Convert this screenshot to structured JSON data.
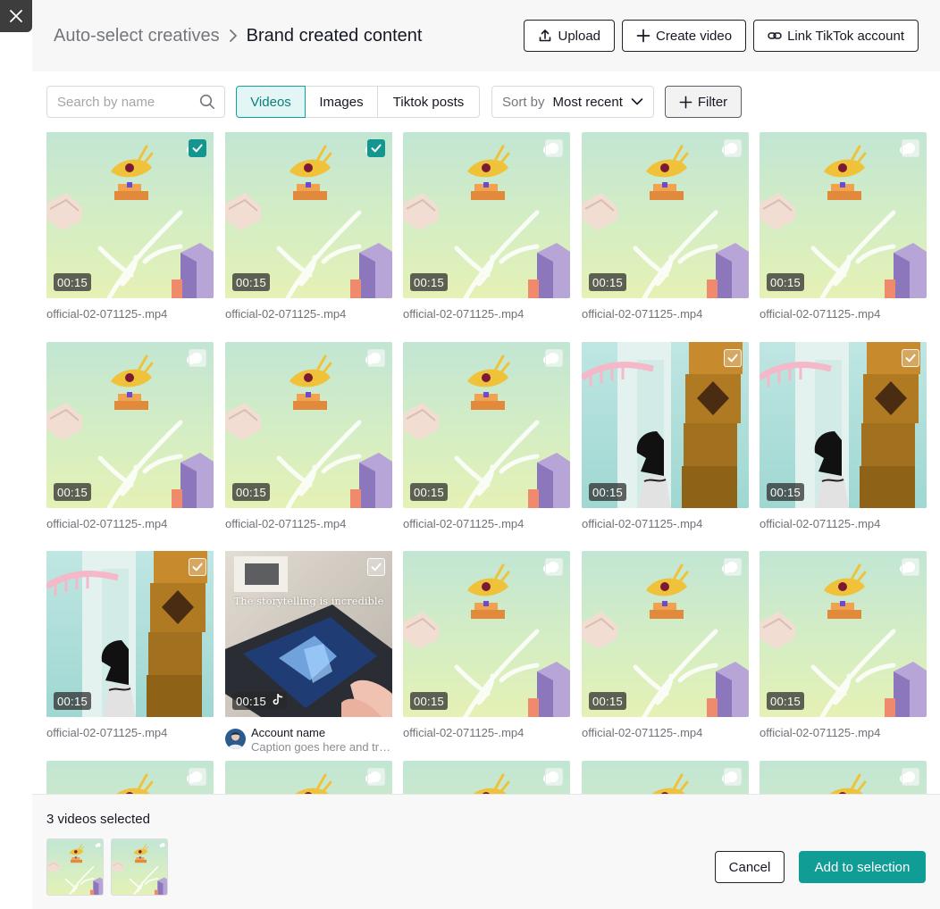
{
  "header": {
    "breadcrumb_parent": "Auto-select creatives",
    "breadcrumb_current": "Brand created content",
    "upload_label": "Upload",
    "create_video_label": "Create video",
    "link_tiktok_label": "Link TikTok account"
  },
  "toolbar": {
    "search_placeholder": "Search by name",
    "tabs": [
      "Videos",
      "Images",
      "Tiktok posts"
    ],
    "active_tab": "Videos",
    "sort_label": "Sort by",
    "sort_value": "Most recent",
    "filter_label": "Filter"
  },
  "grid": {
    "items": [
      {
        "art": "scene",
        "duration": "00:15",
        "name": "official-02-071125-.mp4",
        "checked": true
      },
      {
        "art": "scene",
        "duration": "00:15",
        "name": "official-02-071125-.mp4",
        "checked": true
      },
      {
        "art": "scene",
        "duration": "00:15",
        "name": "official-02-071125-.mp4",
        "checked": false
      },
      {
        "art": "scene",
        "duration": "00:15",
        "name": "official-02-071125-.mp4",
        "checked": false
      },
      {
        "art": "scene",
        "duration": "00:15",
        "name": "official-02-071125-.mp4",
        "checked": false
      },
      {
        "art": "scene",
        "duration": "00:15",
        "name": "official-02-071125-.mp4",
        "checked": false
      },
      {
        "art": "scene",
        "duration": "00:15",
        "name": "official-02-071125-.mp4",
        "checked": false
      },
      {
        "art": "scene",
        "duration": "00:15",
        "name": "official-02-071125-.mp4",
        "checked": false
      },
      {
        "art": "tower",
        "duration": "00:15",
        "name": "official-02-071125-.mp4",
        "checked": false,
        "muted": true
      },
      {
        "art": "tower",
        "duration": "00:15",
        "name": "official-02-071125-.mp4",
        "checked": false,
        "muted": true
      },
      {
        "art": "tower",
        "duration": "00:15",
        "name": "official-02-071125-.mp4",
        "checked": false,
        "muted": true
      },
      {
        "art": "tablet",
        "duration": "00:15",
        "overlay": "The storytelling is incredible",
        "tiktok": true,
        "account": "Account name",
        "caption": "Caption goes here and truncates",
        "checked": false,
        "muted": true
      },
      {
        "art": "scene",
        "duration": "00:15",
        "name": "official-02-071125-.mp4",
        "checked": false
      },
      {
        "art": "scene",
        "duration": "00:15",
        "name": "official-02-071125-.mp4",
        "checked": false
      },
      {
        "art": "scene",
        "duration": "00:15",
        "name": "official-02-071125-.mp4",
        "checked": false
      },
      {
        "art": "scene",
        "checked": false
      },
      {
        "art": "scene",
        "checked": false
      },
      {
        "art": "scene",
        "checked": false
      },
      {
        "art": "scene",
        "checked": false
      },
      {
        "art": "scene",
        "checked": false
      }
    ]
  },
  "footer": {
    "selected_text": "3 videos selected",
    "cancel_label": "Cancel",
    "add_label": "Add to selection"
  },
  "colors": {
    "accent": "#0f9d96",
    "active_tab_bg": "#e3f5f4",
    "header_bg": "#f7f7f8"
  }
}
